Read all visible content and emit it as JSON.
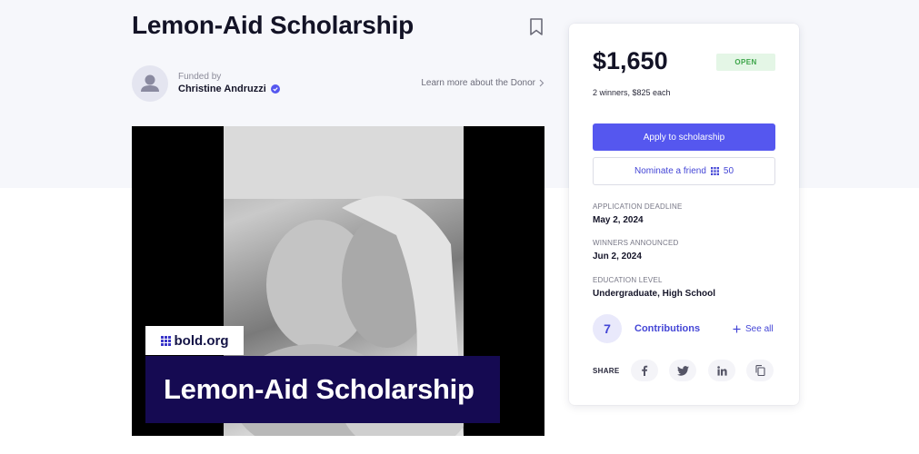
{
  "scholarship": {
    "title": "Lemon-Aid Scholarship"
  },
  "donor": {
    "funded_label": "Funded by",
    "name": "Christine Andruzzi",
    "learn_more": "Learn more about the Donor"
  },
  "hero": {
    "badge_text": "bold.org",
    "banner_text": "Lemon-Aid Scholarship"
  },
  "card": {
    "amount": "$1,650",
    "status": "OPEN",
    "winners": "2 winners, $825 each",
    "apply_label": "Apply to scholarship",
    "nominate_label": "Nominate a friend",
    "nominate_points": "50",
    "fields": [
      {
        "label": "APPLICATION DEADLINE",
        "value": "May 2, 2024"
      },
      {
        "label": "WINNERS ANNOUNCED",
        "value": "Jun 2, 2024"
      },
      {
        "label": "EDUCATION LEVEL",
        "value": "Undergraduate, High School"
      }
    ],
    "contributions_count": "7",
    "contributions_label": "Contributions",
    "see_all": "See all",
    "share_label": "SHARE"
  },
  "colors": {
    "accent": "#5557ef",
    "banner_navy": "#150a52",
    "status_green": "#3ea54a"
  }
}
